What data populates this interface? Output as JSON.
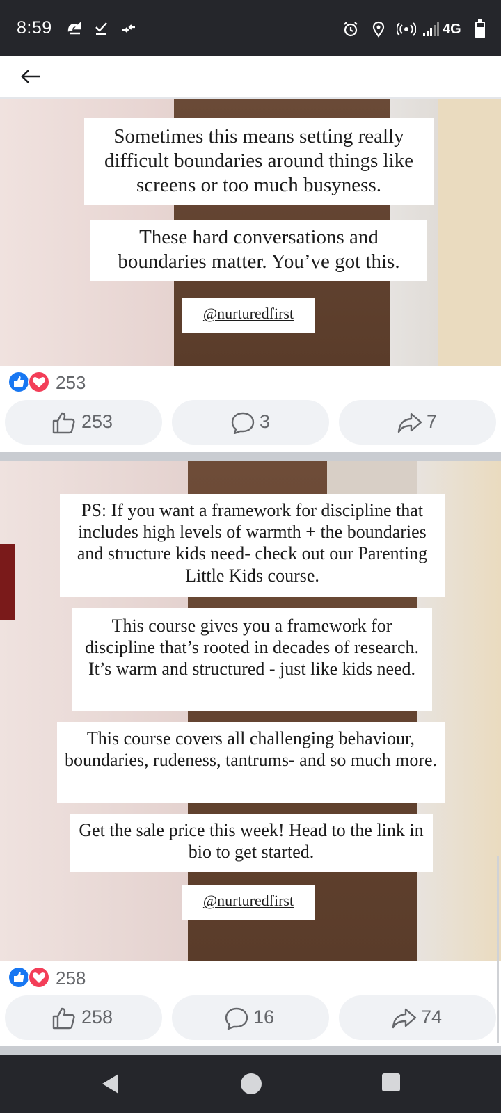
{
  "status_bar": {
    "time": "8:59",
    "network": "4G",
    "left_icons": [
      "cloud-sync-icon",
      "check-icon",
      "data-arrows-icon"
    ],
    "right_icons": [
      "alarm-icon",
      "location-icon",
      "hotspot-icon",
      "signal-icon",
      "battery-icon"
    ]
  },
  "app_bar": {
    "back_icon": "back-arrow-icon"
  },
  "posts": [
    {
      "text_cards": [
        "Sometimes this means setting really difficult boundaries around things like screens or too much busyness.",
        "These hard conversations and boundaries matter. You’ve got this."
      ],
      "handle": "@nurturedfirst",
      "reaction_total": "253",
      "like_count": "253",
      "comment_count": "3",
      "share_count": "7"
    },
    {
      "text_cards": [
        "PS: If you want a framework for discipline that includes high levels of warmth + the boundaries and structure kids need- check out our Parenting Little Kids course.",
        "This course gives you a framework for discipline that’s rooted in decades of research. It’s warm and structured - just like kids need.",
        "This course covers all challenging behaviour, boundaries, rudeness, tantrums- and so much more.",
        "Get the sale price this week! Head to the link in bio to get started."
      ],
      "handle": "@nurturedfirst",
      "reaction_total": "258",
      "like_count": "258",
      "comment_count": "16",
      "share_count": "74"
    }
  ],
  "colors": {
    "status_bar_bg": "#25262b",
    "like_blue": "#1877f2",
    "love_red": "#f33e58",
    "action_btn_bg": "#f0f2f5",
    "meta_text": "#65676b"
  },
  "nav_bar": {
    "buttons": [
      "back-triangle-icon",
      "home-circle-icon",
      "recents-square-icon"
    ]
  }
}
